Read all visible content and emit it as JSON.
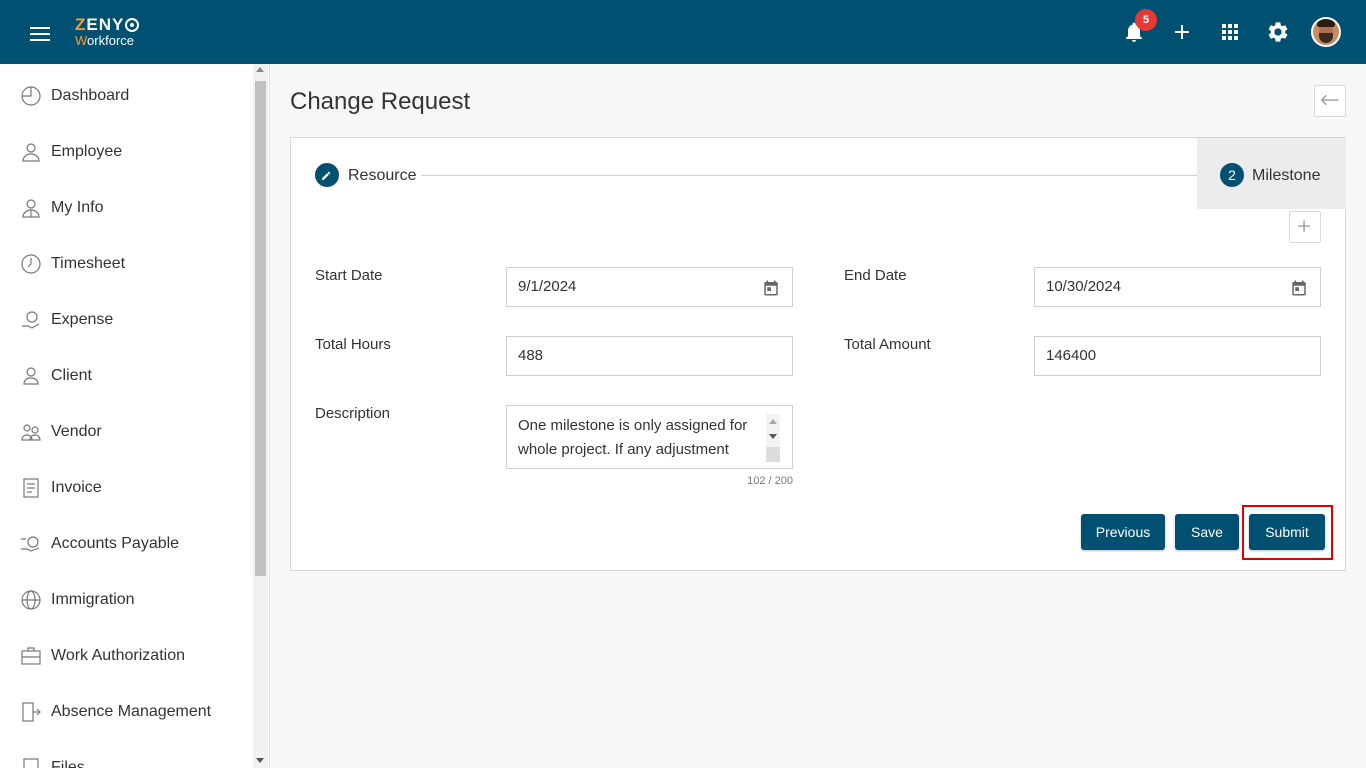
{
  "header": {
    "logo_line1": "ZENY",
    "logo_line2": "Workforce",
    "notification_count": "5",
    "icons": [
      "menu-icon",
      "bell-icon",
      "plus-icon",
      "apps-grid-icon",
      "gear-icon",
      "avatar"
    ],
    "brand_color": "#005072",
    "accent_color": "#f29c38"
  },
  "sidebar": {
    "items": [
      {
        "label": "Dashboard",
        "icon": "dashboard-icon"
      },
      {
        "label": "Employee",
        "icon": "employee-icon"
      },
      {
        "label": "My Info",
        "icon": "my-info-icon"
      },
      {
        "label": "Timesheet",
        "icon": "clock-icon"
      },
      {
        "label": "Expense",
        "icon": "expense-icon"
      },
      {
        "label": "Client",
        "icon": "person-icon"
      },
      {
        "label": "Vendor",
        "icon": "vendor-icon"
      },
      {
        "label": "Invoice",
        "icon": "invoice-icon"
      },
      {
        "label": "Accounts Payable",
        "icon": "accounts-payable-icon"
      },
      {
        "label": "Immigration",
        "icon": "globe-icon"
      },
      {
        "label": "Work Authorization",
        "icon": "briefcase-icon"
      },
      {
        "label": "Absence Management",
        "icon": "door-exit-icon"
      },
      {
        "label": "Files",
        "icon": "file-icon"
      }
    ]
  },
  "page": {
    "title": "Change Request"
  },
  "stepper": {
    "step1_label": "Resource",
    "step2_number": "2",
    "step2_label": "Milestone"
  },
  "form": {
    "start_date_label": "Start Date",
    "start_date_value": "9/1/2024",
    "end_date_label": "End Date",
    "end_date_value": "10/30/2024",
    "total_hours_label": "Total Hours",
    "total_hours_value": "488",
    "total_amount_label": "Total Amount",
    "total_amount_value": "146400",
    "description_label": "Description",
    "description_value": "One milestone is only assigned for whole project. If any adjustment",
    "char_counter": "102 / 200"
  },
  "actions": {
    "previous_label": "Previous",
    "save_label": "Save",
    "submit_label": "Submit",
    "highlight_color": "#e00000"
  }
}
